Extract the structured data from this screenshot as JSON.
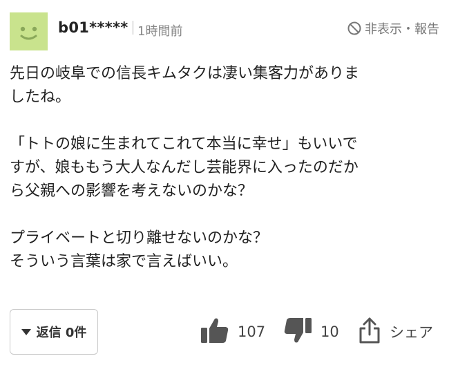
{
  "comment": {
    "username": "b01*****",
    "time": "1時間前",
    "hide_report": "非表示・報告",
    "lines": [
      "先日の岐阜での信長キムタクは凄い集客力がありま",
      "したね。",
      "",
      "「トトの娘に生まれてこれて本当に幸せ」もいいで",
      "すが、娘ももう大人なんだし芸能界に入ったのだか",
      "ら父親への影響を考えないのかな？",
      "",
      "プライベートと切り離せないのかな？",
      "そういう言葉は家で言えばいい。"
    ]
  },
  "footer": {
    "reply_label": "返信 0件",
    "likes": "107",
    "dislikes": "10",
    "share_label": "シェア"
  },
  "colors": {
    "avatar_bg": "#c9e38d",
    "avatar_face": "#8aa85a",
    "icon_gray": "#555555",
    "meta_gray": "#888888"
  },
  "icons": {
    "avatar": "smiley-face-icon",
    "hide": "ban-icon",
    "reply": "triangle-down-icon",
    "like": "thumbs-up-icon",
    "dislike": "thumbs-down-icon",
    "share": "share-icon"
  }
}
